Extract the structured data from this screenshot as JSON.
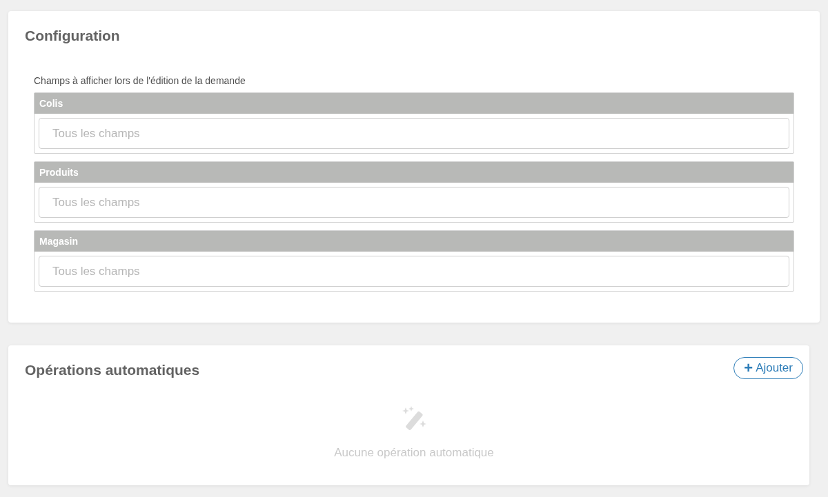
{
  "configuration": {
    "title": "Configuration",
    "fields_label": "Champs à afficher lors de l'édition de la demande",
    "groups": [
      {
        "name": "Colis",
        "placeholder": "Tous les champs"
      },
      {
        "name": "Produits",
        "placeholder": "Tous les champs"
      },
      {
        "name": "Magasin",
        "placeholder": "Tous les champs"
      }
    ]
  },
  "operations": {
    "title": "Opérations automatiques",
    "add_button": {
      "icon": "+",
      "label": "Ajouter"
    },
    "empty_message": "Aucune opération automatique"
  }
}
